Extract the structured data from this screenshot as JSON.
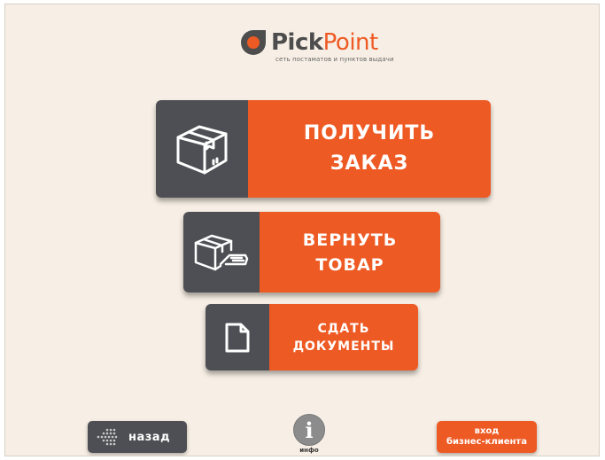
{
  "logo": {
    "brand_pick": "Pick",
    "brand_point": "Point",
    "tagline": "сеть постаматов и пунктов выдачи"
  },
  "actions": {
    "receive_order": {
      "line1": "ПОЛУЧИТЬ",
      "line2": "ЗАКАЗ",
      "icon": "package-box-icon"
    },
    "return_item": {
      "line1": "ВЕРНУТЬ",
      "line2": "ТОВАР",
      "icon": "return-package-hand-icon"
    },
    "submit_documents": {
      "line1": "СДАТЬ",
      "line2": "ДОКУМЕНТЫ",
      "icon": "document-icon"
    }
  },
  "footer": {
    "back_label": "назад",
    "info_label": "инфо",
    "business_line1": "вход",
    "business_line2": "бизнес-клиента"
  },
  "colors": {
    "accent": "#ee5a24",
    "dark": "#4e4f54",
    "background": "#f7efe5"
  }
}
